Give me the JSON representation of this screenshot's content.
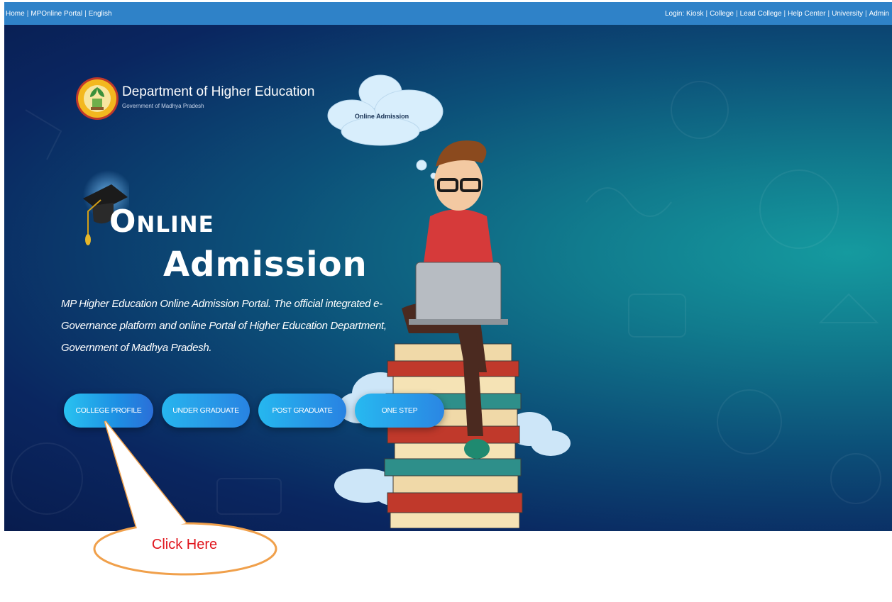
{
  "topbar": {
    "left_links": [
      "Home",
      "MPOnline Portal",
      "English"
    ],
    "right_links": [
      "Login: Kiosk",
      "College",
      "Lead College",
      "Help Center",
      "University",
      "Admin"
    ],
    "separator": "|",
    "color": "#2f82c8"
  },
  "logo": {
    "department": "Department of Higher Education",
    "government": "Government of Madhya Pradesh",
    "icon": "state-emblem-icon"
  },
  "hero": {
    "title_line1": "Online",
    "title_line2": "Admission",
    "description": "MP Higher Education Online Admission Portal. The official integrated e-Governance platform and online Portal of Higher Education Department, Government of Madhya Pradesh.",
    "thought_bubble": "Online Admission",
    "buttons": [
      "College Profile",
      "Under Graduate",
      "Post Graduate",
      "One Step"
    ]
  },
  "callout": {
    "text": "Click Here",
    "border_color": "#f0a04b",
    "text_color": "#e0141c"
  }
}
